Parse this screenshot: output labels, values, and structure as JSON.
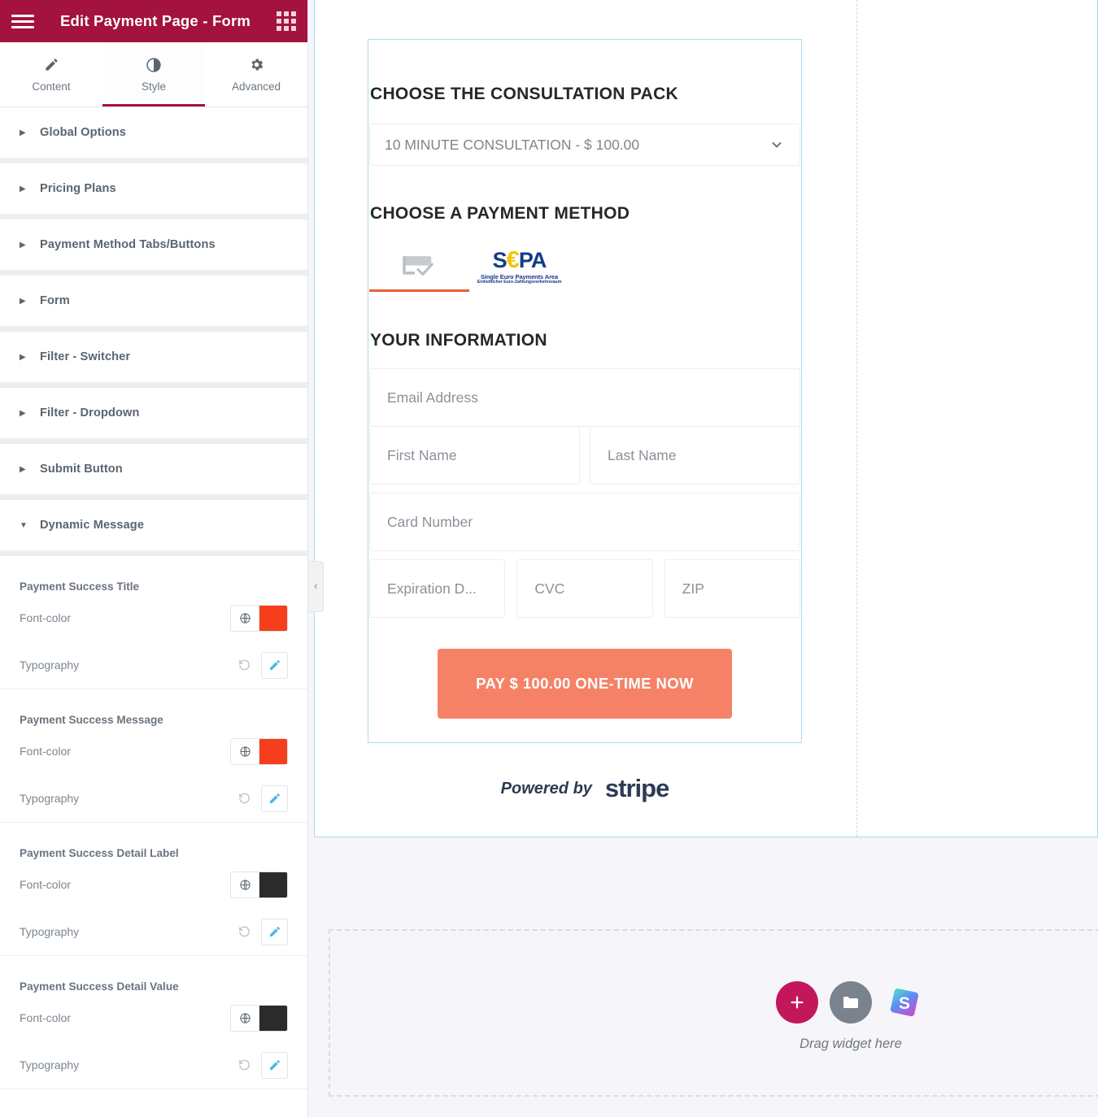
{
  "panel": {
    "title": "Edit Payment Page - Form",
    "menu_icon": "hamburger-icon",
    "widgets_icon": "grid-icon",
    "tabs": [
      {
        "label": "Content",
        "icon": "pencil-icon",
        "active": false
      },
      {
        "label": "Style",
        "icon": "contrast-icon",
        "active": true
      },
      {
        "label": "Advanced",
        "icon": "gear-icon",
        "active": false
      }
    ],
    "sections": [
      {
        "label": "Global Options",
        "expanded": false
      },
      {
        "label": "Pricing Plans",
        "expanded": false
      },
      {
        "label": "Payment Method Tabs/Buttons",
        "expanded": false
      },
      {
        "label": "Form",
        "expanded": false
      },
      {
        "label": "Filter - Switcher",
        "expanded": false
      },
      {
        "label": "Filter - Dropdown",
        "expanded": false
      },
      {
        "label": "Submit Button",
        "expanded": false
      },
      {
        "label": "Dynamic Message",
        "expanded": true
      }
    ],
    "control_groups": [
      {
        "title": "Payment Success Title",
        "font_color_label": "Font-color",
        "color": "#f73e1c",
        "typography_label": "Typography"
      },
      {
        "title": "Payment Success Message",
        "font_color_label": "Font-color",
        "color": "#f73e1c",
        "typography_label": "Typography"
      },
      {
        "title": "Payment Success Detail Label",
        "font_color_label": "Font-color",
        "color": "#2b2b2b",
        "typography_label": "Typography"
      },
      {
        "title": "Payment Success Detail Value",
        "font_color_label": "Font-color",
        "color": "#2b2b2b",
        "typography_label": "Typography"
      }
    ],
    "collapse_icon": "chevron-left-icon"
  },
  "form": {
    "pack_heading": "CHOOSE THE CONSULTATION PACK",
    "pack_selected": "10 MINUTE CONSULTATION - $ 100.00",
    "pack_chevron": "chevron-down-icon",
    "method_heading": "CHOOSE A PAYMENT METHOD",
    "methods": [
      {
        "name": "card-icon",
        "active": true
      },
      {
        "name": "sepa-logo",
        "active": false
      }
    ],
    "sepa": {
      "mark_left": "S",
      "mark_euro": "€",
      "mark_right": "PA",
      "line1": "Single Euro Payments Area",
      "line2": "Einheitlicher Euro-Zahlungsverkehrsraum"
    },
    "info_heading": "YOUR INFORMATION",
    "fields": {
      "email": "Email Address",
      "first_name": "First Name",
      "last_name": "Last Name",
      "card_number": "Card Number",
      "expiration": "Expiration D...",
      "cvc": "CVC",
      "zip": "ZIP"
    },
    "submit_label": "PAY $ 100.00 ONE-TIME NOW",
    "submit_color": "#f58266",
    "footer": {
      "powered_by": "Powered by",
      "provider": "stripe"
    }
  },
  "dropzone": {
    "text": "Drag widget here",
    "add_icon": "plus-icon",
    "folder_icon": "folder-icon",
    "template_icon": "stripe-template-icon"
  }
}
